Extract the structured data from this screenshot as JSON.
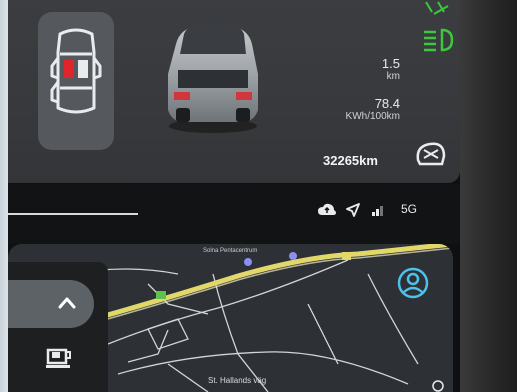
{
  "vehicle": {
    "range_value": "1.5",
    "range_unit": "km",
    "consumption_value": "78.4",
    "consumption_unit": "KWh/100km",
    "odometer": "32265km"
  },
  "status_bar": {
    "network": "5G",
    "icons": [
      "cloud-sync-icon",
      "location-arrow-icon",
      "signal-bars-icon"
    ]
  },
  "map": {
    "place_label": "Solna Pentacentrum",
    "street_label": "St. Hallands väg"
  },
  "indicators": {
    "headlight_color": "#3cc83c",
    "route_color": "#e2d86a"
  },
  "icons": {
    "door_status": "car-doors-icon",
    "tyre_pressure": "tyre-icon",
    "profile": "profile-icon",
    "collapse": "chevron-up-icon",
    "coffee": "coffee-icon"
  }
}
